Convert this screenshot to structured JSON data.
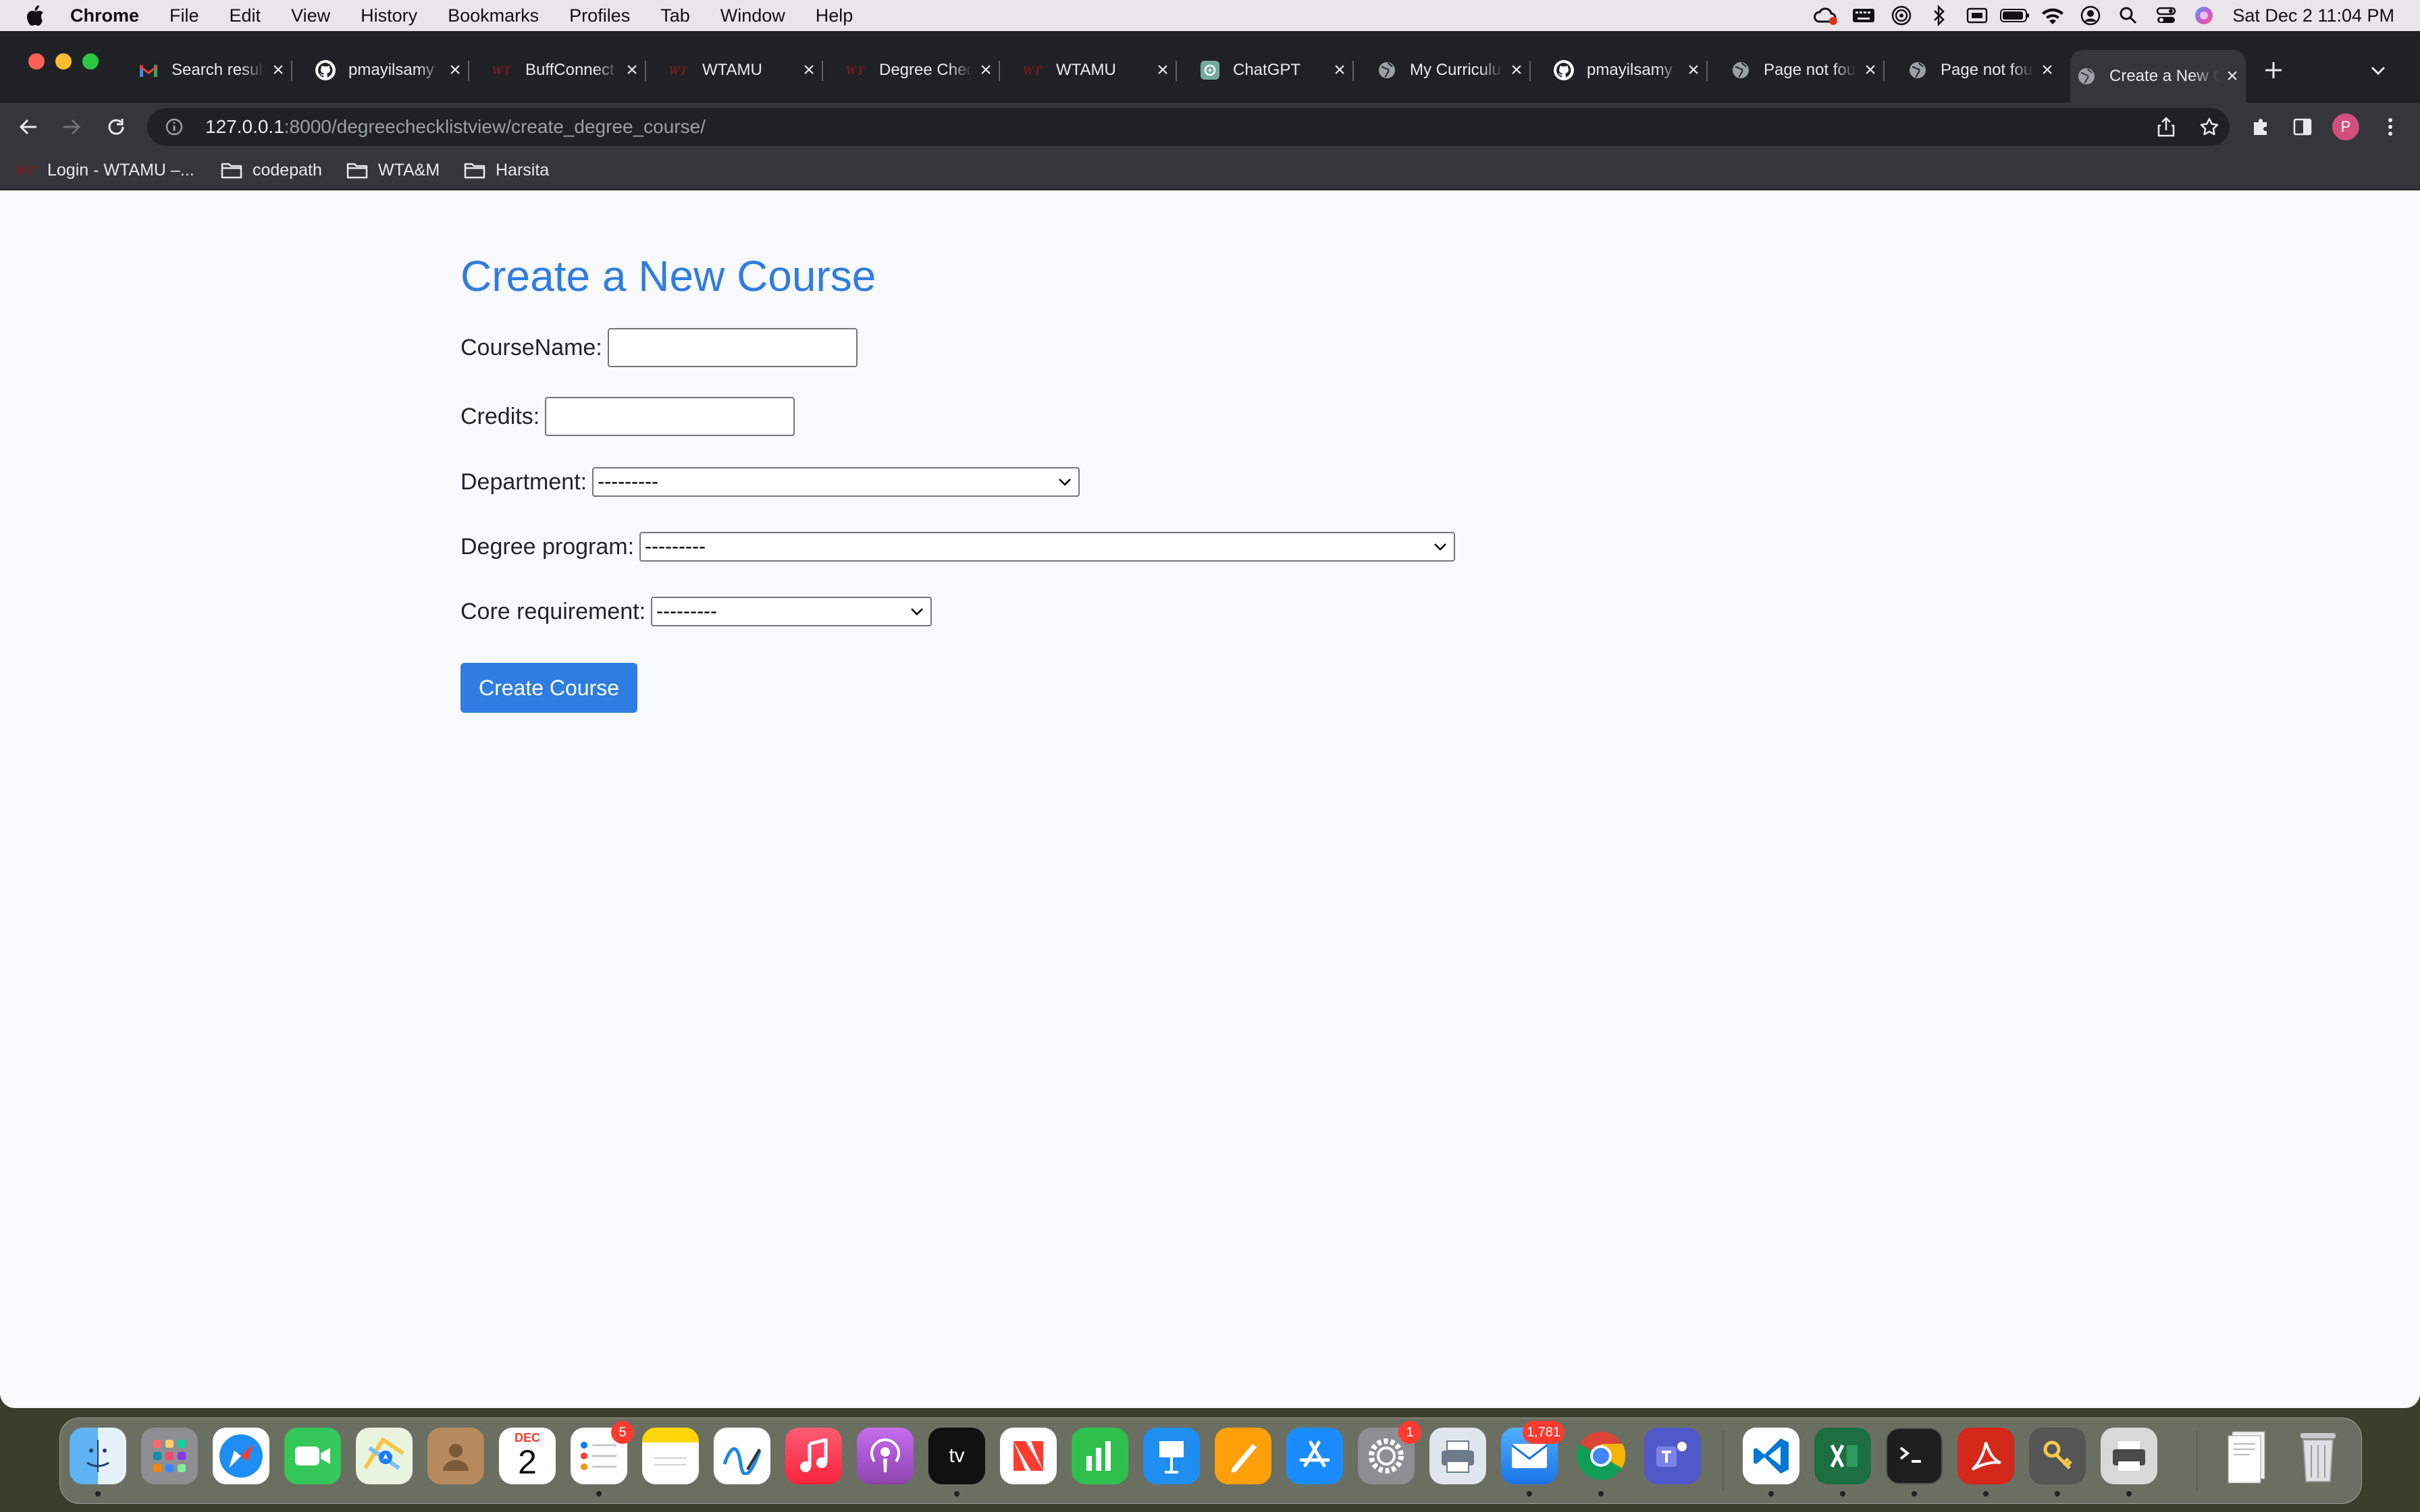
{
  "menubar": {
    "items": [
      "Chrome",
      "File",
      "Edit",
      "View",
      "History",
      "Bookmarks",
      "Profiles",
      "Tab",
      "Window",
      "Help"
    ],
    "clock": "Sat Dec 2  11:04 PM"
  },
  "tabs": [
    {
      "title": "Search results - pmayilsamy@buffs.wtamu.edu - Gmail",
      "icon": "gmail-icon"
    },
    {
      "title": "pmayilsamy",
      "icon": "github-icon"
    },
    {
      "title": "BuffConnect",
      "icon": "wt-icon"
    },
    {
      "title": "WTAMU",
      "icon": "wt-icon"
    },
    {
      "title": "Degree Checklist",
      "icon": "wt-icon"
    },
    {
      "title": "WTAMU",
      "icon": "wt-icon"
    },
    {
      "title": "ChatGPT",
      "icon": "chatgpt-icon"
    },
    {
      "title": "My Curriculum",
      "icon": "globe-icon"
    },
    {
      "title": "pmayilsamy",
      "icon": "github-icon"
    },
    {
      "title": "Page not found",
      "icon": "globe-icon"
    },
    {
      "title": "Page not found",
      "icon": "globe-icon"
    },
    {
      "title": "Create a New Course",
      "icon": "globe-icon"
    }
  ],
  "omnibox": {
    "host": "127.0.0.1",
    "path": ":8000/degreechecklistview/create_degree_course/"
  },
  "avatar_initial": "P",
  "bookmarks": [
    {
      "label": "Login - WTAMU –...",
      "icon": "wt-icon"
    },
    {
      "label": "codepath",
      "icon": "folder-icon"
    },
    {
      "label": "WTA&M",
      "icon": "folder-icon"
    },
    {
      "label": "Harsita",
      "icon": "folder-icon"
    }
  ],
  "page": {
    "title": "Create a New Course",
    "fields": {
      "course_name": {
        "label": "CourseName:",
        "value": ""
      },
      "credits": {
        "label": "Credits:",
        "value": ""
      },
      "department": {
        "label": "Department:",
        "selected": "---------"
      },
      "degree_program": {
        "label": "Degree program:",
        "selected": "---------"
      },
      "core_requirement": {
        "label": "Core requirement:",
        "selected": "---------"
      }
    },
    "submit_label": "Create Course"
  },
  "dock": {
    "calendar_month": "DEC",
    "calendar_day": "2",
    "reminders_badge": "5",
    "settings_badge": "1",
    "mail_badge": "1,781",
    "appletv_label": "tv"
  },
  "colors": {
    "accent": "#2f7de1",
    "page_bg": "#f8f9fa",
    "tabstrip_bg": "#202124",
    "toolbar_bg": "#35363a"
  }
}
